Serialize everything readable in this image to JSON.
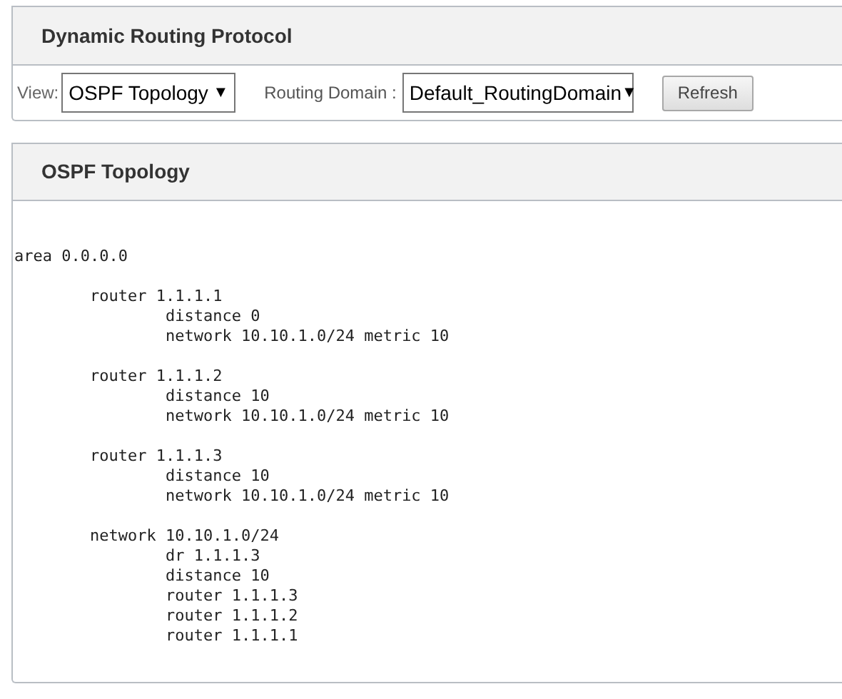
{
  "protocol_panel": {
    "title": "Dynamic Routing Protocol",
    "view_label": "View:",
    "view_select": {
      "value": "OSPF Topology",
      "arrow": "▼"
    },
    "domain_label": "Routing Domain :",
    "domain_select": {
      "value": "Default_RoutingDomain",
      "arrow": "▼"
    },
    "refresh_button": "Refresh"
  },
  "topology_panel": {
    "title": "OSPF Topology",
    "listing": [
      {
        "text": "area 0.0.0.0",
        "children": [
          {
            "text": "router 1.1.1.1",
            "children": [
              {
                "text": "distance 0"
              },
              {
                "text": "network 10.10.1.0/24 metric 10"
              }
            ]
          },
          {
            "text": "router 1.1.1.2",
            "children": [
              {
                "text": "distance 10"
              },
              {
                "text": "network 10.10.1.0/24 metric 10"
              }
            ]
          },
          {
            "text": "router 1.1.1.3",
            "children": [
              {
                "text": "distance 10"
              },
              {
                "text": "network 10.10.1.0/24 metric 10"
              }
            ]
          },
          {
            "text": "network 10.10.1.0/24",
            "children": [
              {
                "text": "dr 1.1.1.3"
              },
              {
                "text": "distance 10"
              },
              {
                "text": "router 1.1.1.3"
              },
              {
                "text": "router 1.1.1.2"
              },
              {
                "text": "router 1.1.1.1"
              }
            ]
          }
        ]
      }
    ]
  }
}
